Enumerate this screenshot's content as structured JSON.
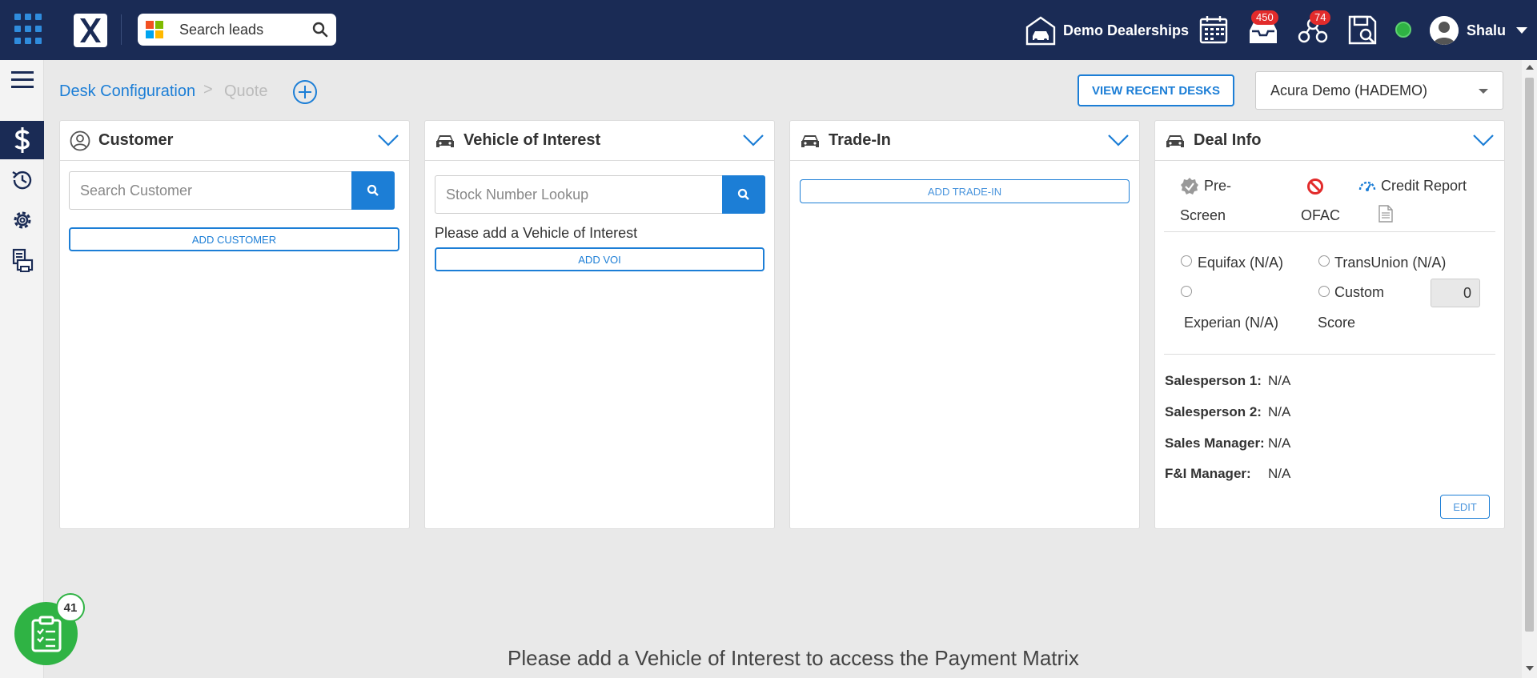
{
  "topbar": {
    "search_placeholder": "Search leads",
    "dealership": "Demo Dealerships",
    "inbox_badge": "450",
    "network_badge": "74",
    "user_name": "Shalu"
  },
  "breadcrumb": {
    "link": "Desk Configuration",
    "separator": ">",
    "current": "Quote"
  },
  "header": {
    "recent_button": "VIEW RECENT DESKS",
    "dealer_select": "Acura Demo (HADEMO)"
  },
  "customer": {
    "title": "Customer",
    "search_placeholder": "Search Customer",
    "add_button": "ADD CUSTOMER"
  },
  "voi": {
    "title": "Vehicle of Interest",
    "search_placeholder": "Stock Number Lookup",
    "message": "Please add a Vehicle of Interest",
    "add_button": "ADD VOI"
  },
  "trade": {
    "title": "Trade-In",
    "add_button": "ADD TRADE-IN"
  },
  "deal": {
    "title": "Deal Info",
    "prescreen_line1": "Pre-",
    "prescreen_line2": "Screen",
    "ofac": "OFAC",
    "credit_report": "Credit Report",
    "equifax": "Equifax (N/A)",
    "transunion": "TransUnion (N/A)",
    "experian": "Experian (N/A)",
    "custom_line1": "Custom",
    "custom_line2": "Score",
    "custom_score": "0",
    "salesperson1_label": "Salesperson 1:",
    "salesperson1_value": "N/A",
    "salesperson2_label": "Salesperson 2:",
    "salesperson2_value": "N/A",
    "sales_manager_label": "Sales Manager:",
    "sales_manager_value": "N/A",
    "fi_manager_label": "F&I Manager:",
    "fi_manager_value": "N/A",
    "edit_button": "EDIT"
  },
  "payment_matrix_message": "Please add a Vehicle of Interest to access the Payment Matrix",
  "tasks_badge": "41",
  "colors": {
    "navy": "#1a2b55",
    "accent_blue": "#1c7ed6",
    "green": "#2fb344",
    "badge_red": "#e22b2b"
  },
  "icons": [
    "apps-grid-icon",
    "logo-x-icon",
    "microsoft-icon",
    "search-icon",
    "dealership-icon",
    "calendar-icon",
    "inbox-icon",
    "network-icon",
    "save-search-icon",
    "status-dot-icon",
    "user-avatar-icon",
    "caret-down-icon",
    "menu-icon",
    "dollar-icon",
    "history-icon",
    "gear-icon",
    "print-icon",
    "add-circle-icon",
    "user-circle-icon",
    "car-icon",
    "chevron-down-icon",
    "badge-check-icon",
    "prohibited-icon",
    "gauge-icon",
    "document-icon",
    "clipboard-icon"
  ]
}
